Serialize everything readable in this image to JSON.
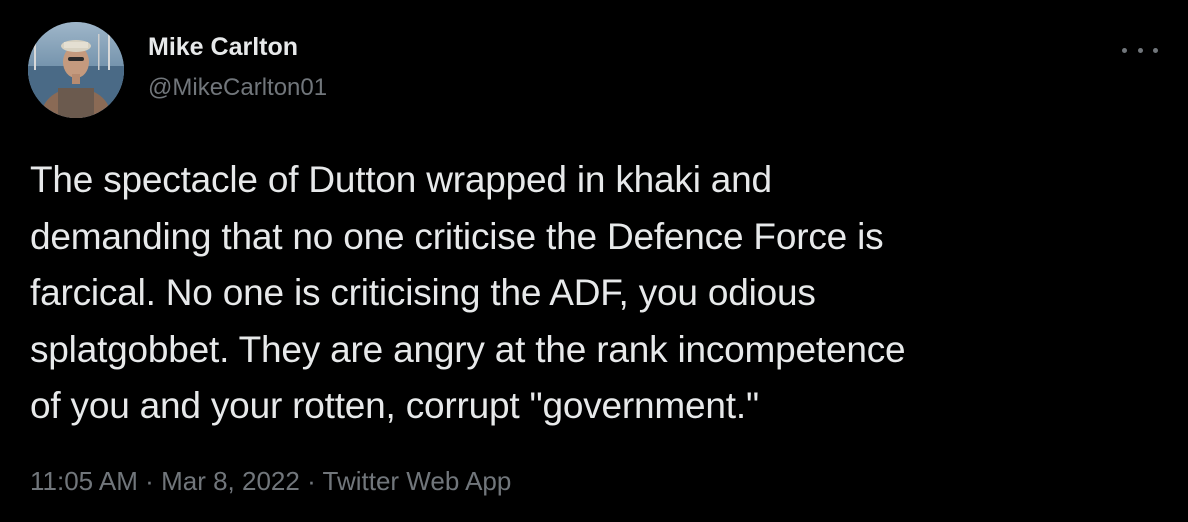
{
  "author": {
    "display_name": "Mike Carlton",
    "handle": "@MikeCarlton01"
  },
  "tweet": {
    "lines": [
      "The spectacle of Dutton wrapped in khaki and",
      "demanding that no one criticise the Defence Force is",
      "farcical. No one is criticising the ADF, you odious",
      "splatgobbet. They are angry at the rank incompetence",
      "of you and your rotten, corrupt \"government.\""
    ]
  },
  "meta": {
    "time": "11:05 AM",
    "separator": "·",
    "date": "Mar 8, 2022",
    "source": "Twitter Web App"
  },
  "icons": {
    "more": "more-horizontal-icon"
  },
  "colors": {
    "background": "#000000",
    "primary_text": "#e7e9ea",
    "secondary_text": "#71767b"
  }
}
